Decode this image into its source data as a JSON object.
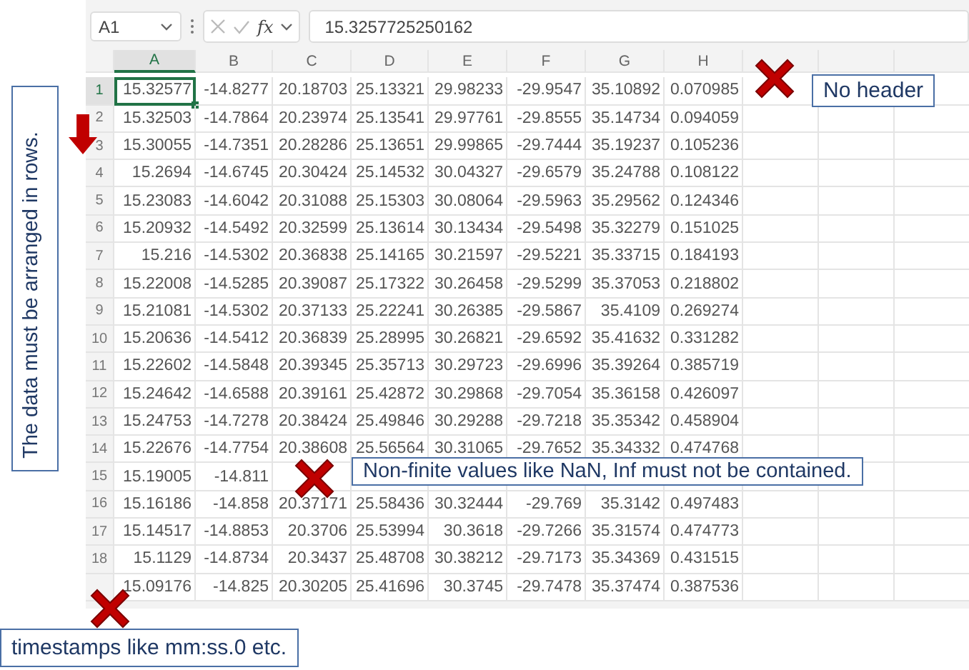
{
  "formula_bar": {
    "name_box": "A1",
    "function_label": "fx",
    "formula": "15.3257725250162"
  },
  "columns": [
    {
      "label": "A",
      "selected": true
    },
    {
      "label": "B",
      "selected": false
    },
    {
      "label": "C",
      "selected": false
    },
    {
      "label": "D",
      "selected": false
    },
    {
      "label": "E",
      "selected": false
    },
    {
      "label": "F",
      "selected": false
    },
    {
      "label": "G",
      "selected": false
    },
    {
      "label": "H",
      "selected": false
    }
  ],
  "rows": [
    {
      "number": "1",
      "selected": true,
      "cells": [
        "15.32577",
        "-14.8277",
        "20.18703",
        "25.13321",
        "29.98233",
        "-29.9547",
        "35.10892",
        "0.070985"
      ]
    },
    {
      "number": "2",
      "selected": false,
      "cells": [
        "15.32503",
        "-14.7864",
        "20.23974",
        "25.13541",
        "29.97761",
        "-29.8555",
        "35.14734",
        "0.094059"
      ]
    },
    {
      "number": "3",
      "selected": false,
      "cells": [
        "15.30055",
        "-14.7351",
        "20.28286",
        "25.13651",
        "29.99865",
        "-29.7444",
        "35.19237",
        "0.105236"
      ]
    },
    {
      "number": "4",
      "selected": false,
      "cells": [
        "15.2694",
        "-14.6745",
        "20.30424",
        "25.14532",
        "30.04327",
        "-29.6579",
        "35.24788",
        "0.108122"
      ]
    },
    {
      "number": "5",
      "selected": false,
      "cells": [
        "15.23083",
        "-14.6042",
        "20.31088",
        "25.15303",
        "30.08064",
        "-29.5963",
        "35.29562",
        "0.124346"
      ]
    },
    {
      "number": "6",
      "selected": false,
      "cells": [
        "15.20932",
        "-14.5492",
        "20.32599",
        "25.13614",
        "30.13434",
        "-29.5498",
        "35.32279",
        "0.151025"
      ]
    },
    {
      "number": "7",
      "selected": false,
      "cells": [
        "15.216",
        "-14.5302",
        "20.36838",
        "25.14165",
        "30.21597",
        "-29.5221",
        "35.33715",
        "0.184193"
      ]
    },
    {
      "number": "8",
      "selected": false,
      "cells": [
        "15.22008",
        "-14.5285",
        "20.39087",
        "25.17322",
        "30.26458",
        "-29.5299",
        "35.37053",
        "0.218802"
      ]
    },
    {
      "number": "9",
      "selected": false,
      "cells": [
        "15.21081",
        "-14.5302",
        "20.37133",
        "25.22241",
        "30.26385",
        "-29.5867",
        "35.4109",
        "0.269274"
      ]
    },
    {
      "number": "10",
      "selected": false,
      "cells": [
        "15.20636",
        "-14.5412",
        "20.36839",
        "25.28995",
        "30.26821",
        "-29.6592",
        "35.41632",
        "0.331282"
      ]
    },
    {
      "number": "11",
      "selected": false,
      "cells": [
        "15.22602",
        "-14.5848",
        "20.39345",
        "25.35713",
        "30.29723",
        "-29.6996",
        "35.39264",
        "0.385719"
      ]
    },
    {
      "number": "12",
      "selected": false,
      "cells": [
        "15.24642",
        "-14.6588",
        "20.39161",
        "25.42872",
        "30.29868",
        "-29.7054",
        "35.36158",
        "0.426097"
      ]
    },
    {
      "number": "13",
      "selected": false,
      "cells": [
        "15.24753",
        "-14.7278",
        "20.38424",
        "25.49846",
        "30.29288",
        "-29.7218",
        "35.35342",
        "0.458904"
      ]
    },
    {
      "number": "14",
      "selected": false,
      "cells": [
        "15.22676",
        "-14.7754",
        "20.38608",
        "25.56564",
        "30.31065",
        "-29.7652",
        "35.34332",
        "0.474768"
      ]
    },
    {
      "number": "15",
      "selected": false,
      "cells": [
        "15.19005",
        "-14.811"
      ]
    },
    {
      "number": "16",
      "selected": false,
      "cells": [
        "15.16186",
        "-14.858",
        "20.37171",
        "25.58436",
        "30.32444",
        "-29.769",
        "35.3142",
        "0.497483"
      ]
    },
    {
      "number": "17",
      "selected": false,
      "cells": [
        "15.14517",
        "-14.8853",
        "20.3706",
        "25.53994",
        "30.3618",
        "-29.7266",
        "35.31574",
        "0.474773"
      ]
    },
    {
      "number": "18",
      "selected": false,
      "cells": [
        "15.1129",
        "-14.8734",
        "20.3437",
        "25.48708",
        "30.38212",
        "-29.7173",
        "35.34369",
        "0.431515"
      ]
    },
    {
      "cells": [
        "15.09176",
        "-14.825",
        "20.30205",
        "25.41696",
        "30.3745",
        "-29.7478",
        "35.37474",
        "0.387536"
      ]
    }
  ],
  "annotations": [
    {
      "kind": "vertical",
      "text": "The data must be arranged in rows."
    },
    {
      "kind": "callout",
      "text": "No header"
    },
    {
      "kind": "callout",
      "text": "Non-finite values like NaN, Inf must not be contained."
    },
    {
      "kind": "callout",
      "text": "timestamps like mm:ss.0 etc."
    }
  ]
}
